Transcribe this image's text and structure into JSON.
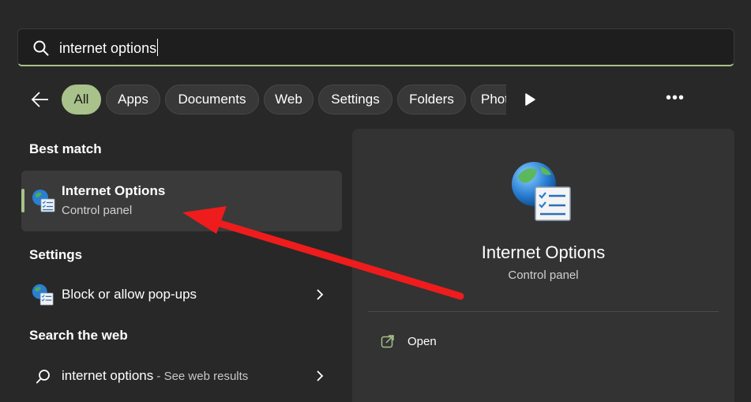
{
  "search": {
    "query": "internet options"
  },
  "filters": {
    "chips": [
      {
        "label": "All",
        "active": true
      },
      {
        "label": "Apps"
      },
      {
        "label": "Documents"
      },
      {
        "label": "Web"
      },
      {
        "label": "Settings"
      },
      {
        "label": "Folders"
      },
      {
        "label": "Photos"
      }
    ],
    "more_label": "•••"
  },
  "left": {
    "best_match_title": "Best match",
    "best_match": {
      "title": "Internet Options",
      "subtitle": "Control panel",
      "icon": "internet-options-icon"
    },
    "settings_title": "Settings",
    "settings_item": {
      "label": "Block or allow pop-ups",
      "icon": "internet-options-icon"
    },
    "web_title": "Search the web",
    "web_item": {
      "label": "internet options",
      "suffix": " - See web results",
      "icon": "search-icon"
    }
  },
  "preview": {
    "title": "Internet Options",
    "subtitle": "Control panel",
    "open_label": "Open"
  },
  "colors": {
    "accent": "#a9c18a",
    "background": "#282828",
    "panel": "#333333",
    "arrow": "#ee1c1c"
  }
}
